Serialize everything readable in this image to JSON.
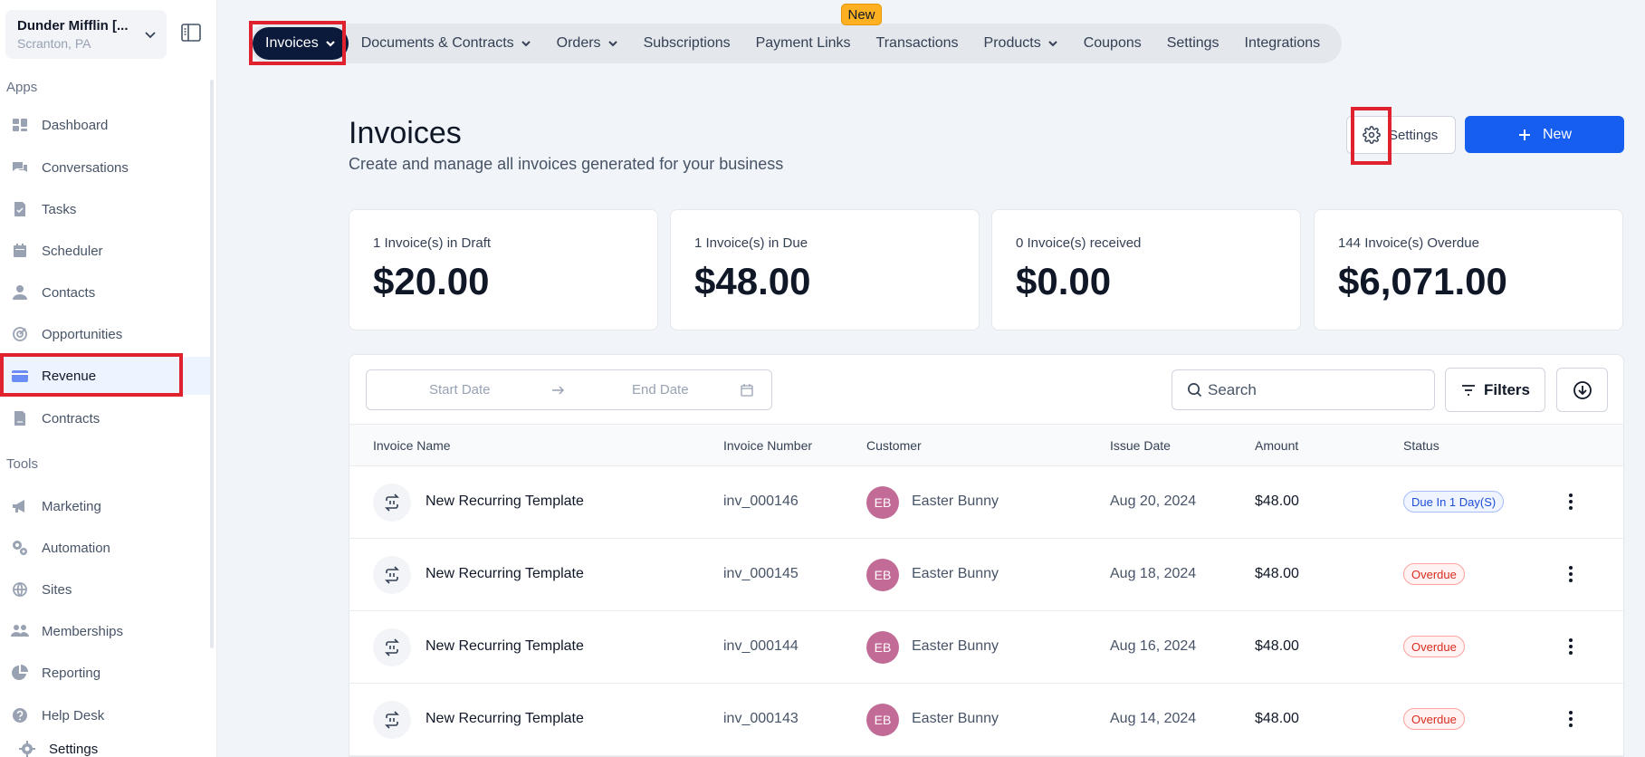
{
  "location": {
    "name": "Dunder Mifflin [...",
    "sub": "Scranton, PA"
  },
  "sidebar": {
    "apps_label": "Apps",
    "tools_label": "Tools",
    "apps": [
      {
        "label": "Dashboard",
        "icon": "dashboard-icon"
      },
      {
        "label": "Conversations",
        "icon": "chat-icon"
      },
      {
        "label": "Tasks",
        "icon": "task-icon"
      },
      {
        "label": "Scheduler",
        "icon": "calendar-icon"
      },
      {
        "label": "Contacts",
        "icon": "person-icon"
      },
      {
        "label": "Opportunities",
        "icon": "target-icon"
      },
      {
        "label": "Revenue",
        "icon": "card-icon",
        "active": true
      },
      {
        "label": "Contracts",
        "icon": "document-icon"
      }
    ],
    "tools": [
      {
        "label": "Marketing",
        "icon": "megaphone-icon"
      },
      {
        "label": "Automation",
        "icon": "gears-icon"
      },
      {
        "label": "Sites",
        "icon": "globe-icon"
      },
      {
        "label": "Memberships",
        "icon": "people-icon"
      },
      {
        "label": "Reporting",
        "icon": "pie-icon"
      },
      {
        "label": "Help Desk",
        "icon": "help-icon"
      },
      {
        "label": "Settings",
        "icon": "gear-icon"
      }
    ]
  },
  "tabs": {
    "new_badge": "New",
    "items": [
      {
        "label": "Invoices"
      },
      {
        "label": "Documents & Contracts"
      },
      {
        "label": "Orders"
      },
      {
        "label": "Subscriptions"
      },
      {
        "label": "Payment Links"
      },
      {
        "label": "Transactions"
      },
      {
        "label": "Products"
      },
      {
        "label": "Coupons"
      },
      {
        "label": "Settings"
      },
      {
        "label": "Integrations"
      }
    ]
  },
  "header": {
    "title": "Invoices",
    "subtitle": "Create and manage all invoices generated for your business",
    "settings_label": "Settings",
    "new_label": "New"
  },
  "stats": [
    {
      "label": "1 Invoice(s) in Draft",
      "value": "$20.00"
    },
    {
      "label": "1 Invoice(s) in Due",
      "value": "$48.00"
    },
    {
      "label": "0 Invoice(s) received",
      "value": "$0.00"
    },
    {
      "label": "144 Invoice(s) Overdue",
      "value": "$6,071.00"
    }
  ],
  "toolbar": {
    "start_placeholder": "Start Date",
    "end_placeholder": "End Date",
    "search_placeholder": "Search",
    "filters_label": "Filters"
  },
  "table": {
    "columns": {
      "name": "Invoice Name",
      "number": "Invoice Number",
      "customer": "Customer",
      "issue_date": "Issue Date",
      "amount": "Amount",
      "status": "Status"
    },
    "rows": [
      {
        "name": "New Recurring Template",
        "number": "inv_000146",
        "initials": "EB",
        "customer": "Easter Bunny",
        "date": "Aug 20, 2024",
        "amount": "$48.00",
        "status": "Due In 1 Day(S)"
      },
      {
        "name": "New Recurring Template",
        "number": "inv_000145",
        "initials": "EB",
        "customer": "Easter Bunny",
        "date": "Aug 18, 2024",
        "amount": "$48.00",
        "status": "Overdue"
      },
      {
        "name": "New Recurring Template",
        "number": "inv_000144",
        "initials": "EB",
        "customer": "Easter Bunny",
        "date": "Aug 16, 2024",
        "amount": "$48.00",
        "status": "Overdue"
      },
      {
        "name": "New Recurring Template",
        "number": "inv_000143",
        "initials": "EB",
        "customer": "Easter Bunny",
        "date": "Aug 14, 2024",
        "amount": "$48.00",
        "status": "Overdue"
      }
    ]
  },
  "colors": {
    "accent": "#155eef",
    "active_tab": "#0b1a3b",
    "highlight": "#e0212e",
    "avatar": "#c26b97"
  }
}
